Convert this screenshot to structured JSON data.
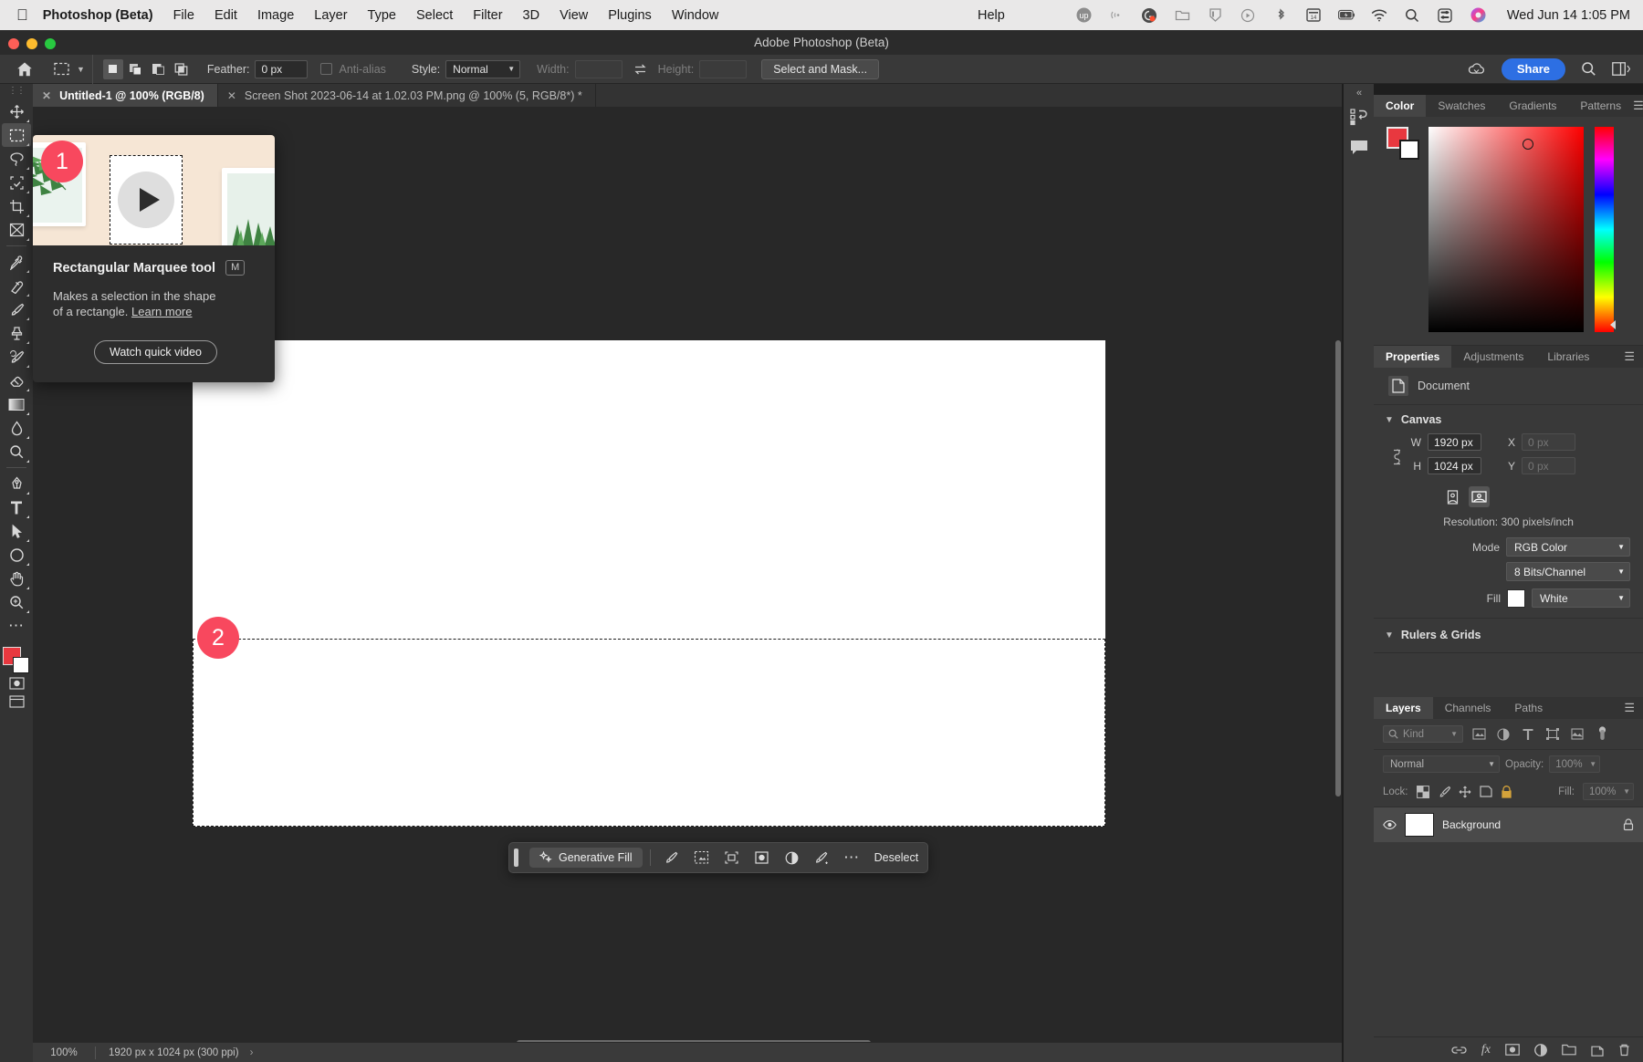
{
  "menubar": {
    "apple_icon": "apple-logo-icon",
    "app_name": "Photoshop (Beta)",
    "menus": [
      "File",
      "Edit",
      "Image",
      "Layer",
      "Type",
      "Select",
      "Filter",
      "3D",
      "View",
      "Plugins",
      "Window"
    ],
    "help": "Help",
    "status_icons": [
      "upwork-icon",
      "airdrop-icon",
      "grammarly-icon",
      "dropbox-icon",
      "nordvpn-icon",
      "screen-recorder-icon",
      "bluetooth-icon",
      "calendar-icon",
      "battery-icon",
      "wifi-icon",
      "spotlight-search-icon",
      "control-center-icon",
      "siri-icon"
    ],
    "clock": "Wed Jun 14  1:05 PM"
  },
  "titlebar": {
    "title": "Adobe Photoshop (Beta)",
    "traffic": {
      "close": "#ff5f57",
      "minimize": "#febc2e",
      "zoom": "#28c840"
    }
  },
  "optionsbar": {
    "home_icon": "home-icon",
    "tool_icon": "rectangular-marquee-icon",
    "tool_dropdown_icon": "chevron-down-icon",
    "selection_modes": [
      "new-selection-icon",
      "add-to-selection-icon",
      "subtract-from-selection-icon",
      "intersect-with-selection-icon"
    ],
    "feather_label": "Feather:",
    "feather_value": "0 px",
    "antialias_label": "Anti-alias",
    "style_label": "Style:",
    "style_value": "Normal",
    "width_label": "Width:",
    "width_value": "",
    "swap_icon": "swap-width-height-icon",
    "height_label": "Height:",
    "height_value": "",
    "select_and_mask": "Select and Mask...",
    "cloud_icon": "cloud-documents-icon",
    "share_label": "Share",
    "search_icon": "search-icon",
    "workspace_icon": "workspace-switcher-icon"
  },
  "tabs": [
    {
      "label": "Untitled-1 @ 100% (RGB/8)",
      "active": true,
      "close_icon": "close-icon"
    },
    {
      "label": "Screen Shot 2023-06-14 at 1.02.03 PM.png @ 100% (5, RGB/8*) *",
      "active": false,
      "close_icon": "close-icon"
    }
  ],
  "toolbar": {
    "tools": [
      "move-tool-icon",
      "rectangular-marquee-tool-icon",
      "lasso-tool-icon",
      "object-selection-tool-icon",
      "crop-tool-icon",
      "frame-tool-icon",
      "eyedropper-tool-icon",
      "spot-healing-brush-tool-icon",
      "brush-tool-icon",
      "clone-stamp-tool-icon",
      "history-brush-tool-icon",
      "eraser-tool-icon",
      "gradient-tool-icon",
      "blur-tool-icon",
      "dodge-tool-icon",
      "pen-tool-icon",
      "type-tool-icon",
      "path-selection-tool-icon",
      "ellipse-tool-icon",
      "hand-tool-icon",
      "zoom-tool-icon",
      "edit-toolbar-icon"
    ],
    "selected_tool": "rectangular-marquee-tool-icon",
    "foreground_color": "#e8383f",
    "background_color": "#ffffff",
    "quick_mask_icon": "quick-mask-icon",
    "screen_mode_icon": "screen-mode-icon"
  },
  "tooltip": {
    "callout_1": "1",
    "callout_2": "2",
    "title": "Rectangular Marquee tool",
    "shortcut": "M",
    "description": "Makes a selection in the shape of a rectangle.",
    "learn_more": "Learn more",
    "watch_video": "Watch quick video",
    "play_icon": "play-icon"
  },
  "context_bar": {
    "grip_icon": "drag-handle-icon",
    "generative_fill_label": "Generative Fill",
    "generative_fill_icon": "generative-ai-sparkle-icon",
    "icons": [
      "select-subject-icon",
      "remove-background-icon",
      "transform-selection-icon",
      "create-mask-icon",
      "adjustment-layer-icon",
      "invert-selection-icon",
      "more-options-icon"
    ],
    "deselect_label": "Deselect"
  },
  "statusbar": {
    "zoom": "100%",
    "dimensions": "1920 px x 1024 px (300 ppi)",
    "arrow_icon": "chevron-right-icon"
  },
  "dock_strip": {
    "collapse_icon": "collapse-panels-icon",
    "icons": [
      "history-icon",
      "comments-icon"
    ]
  },
  "color_panel": {
    "tabs": [
      {
        "label": "Color",
        "active": true
      },
      {
        "label": "Swatches",
        "active": false
      },
      {
        "label": "Gradients",
        "active": false
      },
      {
        "label": "Patterns",
        "active": false
      }
    ],
    "menu_icon": "panel-menu-icon",
    "foreground_swatch": "#e8383f",
    "background_swatch": "#ffffff",
    "picker_ring": "color-picker-ring-icon",
    "hue_slider_icon": "hue-slider-icon"
  },
  "properties_panel": {
    "tabs": [
      {
        "label": "Properties",
        "active": true
      },
      {
        "label": "Adjustments",
        "active": false
      },
      {
        "label": "Libraries",
        "active": false
      }
    ],
    "menu_icon": "panel-menu-icon",
    "document_icon": "document-icon",
    "document_label": "Document",
    "canvas_section": "Canvas",
    "link_icon": "link-dimensions-icon",
    "w_label": "W",
    "w_value": "1920 px",
    "h_label": "H",
    "h_value": "1024 px",
    "x_label": "X",
    "x_value": "0 px",
    "y_label": "Y",
    "y_value": "0 px",
    "portrait_icon": "portrait-orientation-icon",
    "landscape_icon": "landscape-orientation-icon",
    "resolution": "Resolution: 300 pixels/inch",
    "mode_label": "Mode",
    "mode_value": "RGB Color",
    "depth_value": "8 Bits/Channel",
    "fill_label": "Fill",
    "fill_swatch": "#ffffff",
    "fill_value": "White",
    "rulers_section": "Rulers & Grids"
  },
  "layers_panel": {
    "tabs": [
      {
        "label": "Layers",
        "active": true
      },
      {
        "label": "Channels",
        "active": false
      },
      {
        "label": "Paths",
        "active": false
      }
    ],
    "menu_icon": "panel-menu-icon",
    "filter_kind": "Kind",
    "filter_search_icon": "search-icon",
    "filter_icons": [
      "filter-pixel-icon",
      "filter-adjustment-icon",
      "filter-type-icon",
      "filter-shape-icon",
      "filter-smart-object-icon"
    ],
    "filter_toggle_icon": "filter-toggle-icon",
    "blend_mode": "Normal",
    "opacity_label": "Opacity:",
    "opacity_value": "100%",
    "lock_label": "Lock:",
    "lock_icons": [
      "lock-transparent-pixels-icon",
      "lock-image-pixels-icon",
      "lock-position-icon",
      "lock-artboard-icon",
      "lock-all-icon"
    ],
    "fill_label": "Fill:",
    "fill_value": "100%",
    "layers": [
      {
        "name": "Background",
        "visible": true,
        "locked": true,
        "visibility_icon": "eye-icon",
        "lock_icon": "lock-icon"
      }
    ],
    "footer_icons": [
      "link-layers-icon",
      "layer-style-icon",
      "layer-mask-icon",
      "adjustment-layer-icon",
      "new-group-icon",
      "new-layer-icon",
      "delete-layer-icon"
    ]
  },
  "canvas": {
    "background": "#ffffff",
    "selection_label": "rectangular-marquee-selection"
  }
}
